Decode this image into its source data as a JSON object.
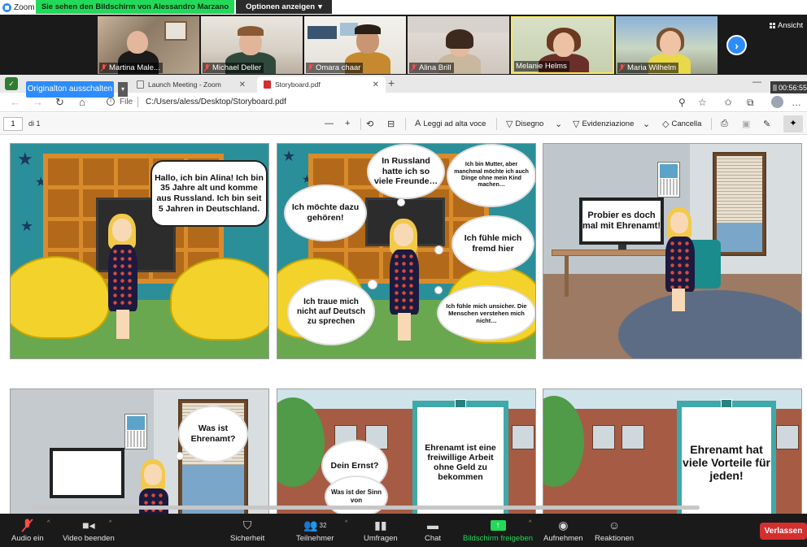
{
  "zoom": {
    "app_title": "Zoom",
    "share_banner": "Sie sehen den Bildschirm von Alessandro Marzano",
    "options_button": "Optionen anzeigen",
    "view_button": "Ansicht",
    "participants": [
      {
        "name": "Martina Male..."
      },
      {
        "name": "Michael Deller"
      },
      {
        "name": "Omara chaar"
      },
      {
        "name": "Alina Brill"
      },
      {
        "name": "Melanie Helms"
      },
      {
        "name": "Maria Wilhelm"
      }
    ],
    "toolbar": {
      "audio": "Audio ein",
      "video": "Video beenden",
      "security": "Sicherheit",
      "participants": "Teilnehmer",
      "participant_count": "32",
      "polls": "Umfragen",
      "chat": "Chat",
      "share": "Bildschirm freigeben",
      "record": "Aufnehmen",
      "reactions": "Reaktionen",
      "leave": "Verlassen"
    },
    "active_speaker_color": "#fce94f",
    "share_color": "#23d959",
    "leave_color": "#d32f2f"
  },
  "browser": {
    "tooltip": "Originalton ausschalten",
    "tabs": [
      {
        "label": "Launch Meeting - Zoom"
      },
      {
        "label": "Storyboard.pdf"
      }
    ],
    "timer": "00:56:55",
    "address_scheme": "File",
    "address_url": "C:/Users/aless/Desktop/Storyboard.pdf"
  },
  "pdf": {
    "page_current": "1",
    "page_total": "di 1",
    "read_aloud": "Leggi ad alta voce",
    "draw": "Disegno",
    "highlight": "Evidenziazione",
    "erase": "Cancella"
  },
  "comic": {
    "p1_speech": "Hallo, ich bin Alina! Ich bin 35 Jahre alt und komme aus Russland. Ich bin seit 5 Jahren in Deutschland.",
    "p2_t1": "In Russland hatte ich so viele Freunde…",
    "p2_t2": "Ich bin Mutter, aber manchmal möchte ich auch Dinge ohne mein Kind machen…",
    "p2_t3": "Ich möchte dazu gehören!",
    "p2_t4": "Ich fühle mich fremd hier",
    "p2_t5": "Ich traue mich nicht auf Deutsch zu sprechen",
    "p2_t6": "Ich fühle mich unsicher. Die Menschen verstehen mich nicht…",
    "p3_screen": "Probier es doch mal mit Ehrenamt!",
    "p4_thought": "Was ist Ehrenamt?",
    "p5_t1": "Dein Ernst?",
    "p5_t2": "Was ist der Sinn von",
    "p5_sign": "Ehrenamt ist eine freiwillige Arbeit ohne Geld zu bekommen",
    "p6_sign": "Ehrenamt hat viele Vorteile für jeden!"
  }
}
